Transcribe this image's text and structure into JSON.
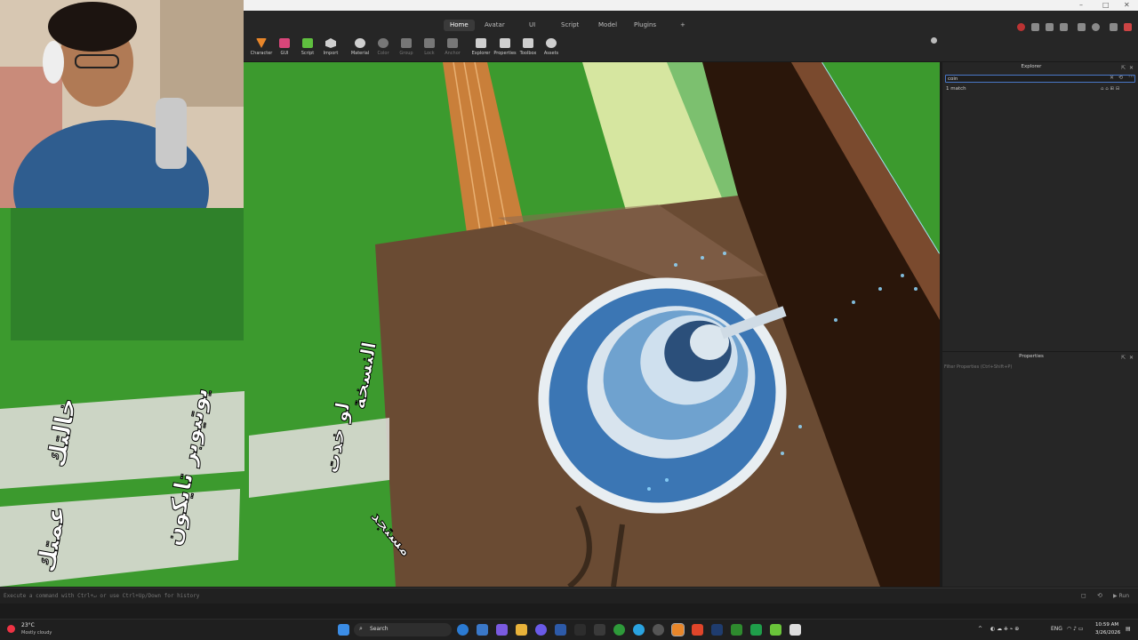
{
  "window": {
    "controls": [
      "–",
      "□",
      "✕"
    ]
  },
  "menu": {
    "tabs": [
      {
        "label": "Home",
        "active": true
      },
      {
        "label": "Avatar",
        "active": false
      },
      {
        "label": "UI",
        "active": false
      },
      {
        "label": "Script",
        "active": false
      },
      {
        "label": "Model",
        "active": false
      },
      {
        "label": "Plugins",
        "active": false
      }
    ],
    "add_tab": "+"
  },
  "toolbar": {
    "tools": [
      {
        "label": "Character",
        "icon": "character-icon",
        "color": "#e8862a"
      },
      {
        "label": "GUI",
        "icon": "gui-icon",
        "color": "#d9467a"
      },
      {
        "label": "Script",
        "icon": "script-icon",
        "color": "#5fbf3f"
      },
      {
        "label": "Import",
        "icon": "import-icon",
        "color": "#cfcfcf"
      },
      {
        "label": "Material",
        "icon": "material-icon",
        "color": "#cfcfcf"
      },
      {
        "label": "Color",
        "icon": "color-icon",
        "color": "#777777"
      },
      {
        "label": "Group",
        "icon": "group-icon",
        "color": "#777777"
      },
      {
        "label": "Lock",
        "icon": "lock-icon",
        "color": "#777777"
      },
      {
        "label": "Anchor",
        "icon": "anchor-icon",
        "color": "#777777"
      },
      {
        "label": "Explorer",
        "icon": "explorer-icon",
        "color": "#cfcfcf"
      },
      {
        "label": "Properties",
        "icon": "properties-icon",
        "color": "#cfcfcf"
      },
      {
        "label": "Toolbox",
        "icon": "toolbox-icon",
        "color": "#cfcfcf"
      },
      {
        "label": "Assets",
        "icon": "assets-icon",
        "color": "#cfcfcf"
      }
    ]
  },
  "explorer": {
    "title": "Explorer",
    "search_value": "coin",
    "match_text": "1 match"
  },
  "properties": {
    "title": "Properties",
    "filter_placeholder": "Filter Properties (Ctrl+Shift+P)"
  },
  "command_bar": {
    "placeholder": "Execute a command with Ctrl+↵ or use Ctrl+Up/Down for history",
    "run_label": "Run"
  },
  "viewport_text": {
    "arabic_1": "النسخة",
    "arabic_2": "لو خدت",
    "arabic_3": "يوتيوبر تايكون",
    "arabic_4": "خالتك",
    "arabic_5": "عمتك",
    "arabic_6": "مستجد"
  },
  "taskbar": {
    "weather_temp": "23°C",
    "weather_desc": "Mostly cloudy",
    "search_label": "Search",
    "language": "ENG",
    "time": "10:59 AM",
    "date": "3/26/2026"
  },
  "colors": {
    "accent": "#4a78c8",
    "grass": "#3c9a2e",
    "wood": "#6a4b33",
    "water": "#3b76b4"
  }
}
